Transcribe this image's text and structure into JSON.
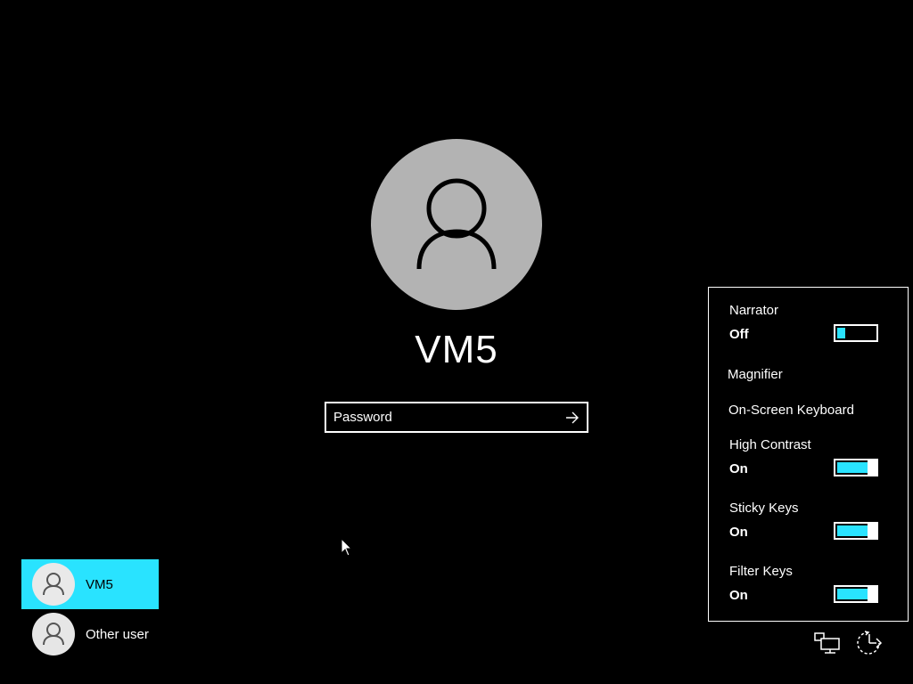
{
  "user": {
    "name": "VM5"
  },
  "password": {
    "placeholder": "Password",
    "value": ""
  },
  "user_list": [
    {
      "name": "VM5",
      "selected": true
    },
    {
      "name": "Other user",
      "selected": false
    }
  ],
  "ease_of_access": {
    "narrator": {
      "label": "Narrator",
      "state": "Off"
    },
    "magnifier": {
      "label": "Magnifier"
    },
    "onscreen_keyboard": {
      "label": "On-Screen Keyboard"
    },
    "high_contrast": {
      "label": "High Contrast",
      "state": "On"
    },
    "sticky_keys": {
      "label": "Sticky Keys",
      "state": "On"
    },
    "filter_keys": {
      "label": "Filter Keys",
      "state": "On"
    }
  },
  "bottom_icons": [
    "network-icon",
    "ease-of-access-icon"
  ],
  "colors": {
    "accent": "#29e3ff",
    "background": "#000000",
    "avatar": "#b3b3b3"
  }
}
